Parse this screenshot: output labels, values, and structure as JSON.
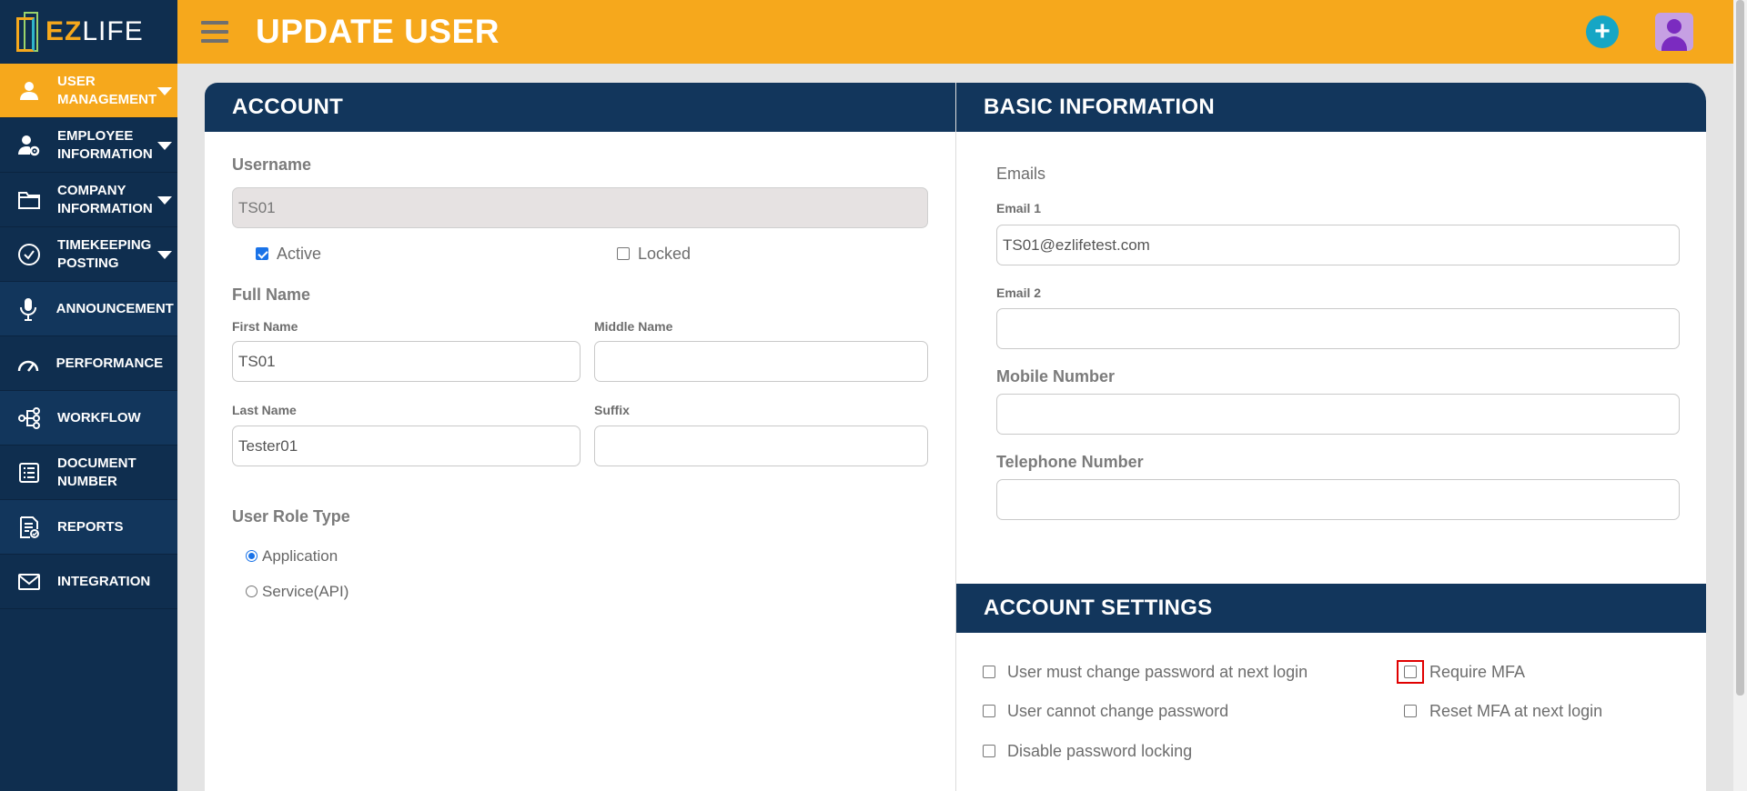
{
  "brand": {
    "ez": "EZ",
    "life": "LIFE"
  },
  "header": {
    "title": "UPDATE USER",
    "add_symbol": "+"
  },
  "sidebar": {
    "items": [
      {
        "label": "USER MANAGEMENT",
        "icon": "user-icon",
        "active": true,
        "has_submenu": true
      },
      {
        "label": "EMPLOYEE INFORMATION",
        "icon": "user-gear-icon",
        "has_submenu": true
      },
      {
        "label": "COMPANY INFORMATION",
        "icon": "folder-icon",
        "has_submenu": true
      },
      {
        "label": "TIMEKEEPING POSTING",
        "icon": "check-circle-icon",
        "has_submenu": true
      },
      {
        "label": "ANNOUNCEMENT",
        "icon": "microphone-icon"
      },
      {
        "label": "PERFORMANCE",
        "icon": "gauge-icon"
      },
      {
        "label": "WORKFLOW",
        "icon": "workflow-icon"
      },
      {
        "label": "DOCUMENT NUMBER",
        "icon": "document-list-icon"
      },
      {
        "label": "REPORTS",
        "icon": "report-icon"
      },
      {
        "label": "INTEGRATION",
        "icon": "envelope-icon"
      }
    ]
  },
  "account": {
    "header": "ACCOUNT",
    "username_label": "Username",
    "username_value": "TS01",
    "active_label": "Active",
    "active_checked": true,
    "locked_label": "Locked",
    "locked_checked": false,
    "full_name_label": "Full Name",
    "first_name_label": "First Name",
    "first_name_value": "TS01",
    "middle_name_label": "Middle Name",
    "middle_name_value": "",
    "last_name_label": "Last Name",
    "last_name_value": "Tester01",
    "suffix_label": "Suffix",
    "suffix_value": "",
    "role_type_label": "User Role Type",
    "role_options": [
      "Application",
      "Service(API)"
    ],
    "role_selected": "Application"
  },
  "basic_info": {
    "header": "BASIC INFORMATION",
    "emails_label": "Emails",
    "email1_label": "Email 1",
    "email1_value": "TS01@ezlifetest.com",
    "email2_label": "Email 2",
    "email2_value": "",
    "mobile_label": "Mobile Number",
    "mobile_value": "",
    "telephone_label": "Telephone Number",
    "telephone_value": ""
  },
  "account_settings": {
    "header": "ACCOUNT SETTINGS",
    "must_change_password": "User must change password at next login",
    "cannot_change_password": "User cannot change password",
    "disable_password_locking": "Disable password locking",
    "require_mfa": "Require MFA",
    "reset_mfa": "Reset MFA at next login"
  },
  "colors": {
    "accent": "#f6a81c",
    "navy": "#12365c",
    "sidebar": "#0f2e4f",
    "add": "#16a6c5"
  }
}
